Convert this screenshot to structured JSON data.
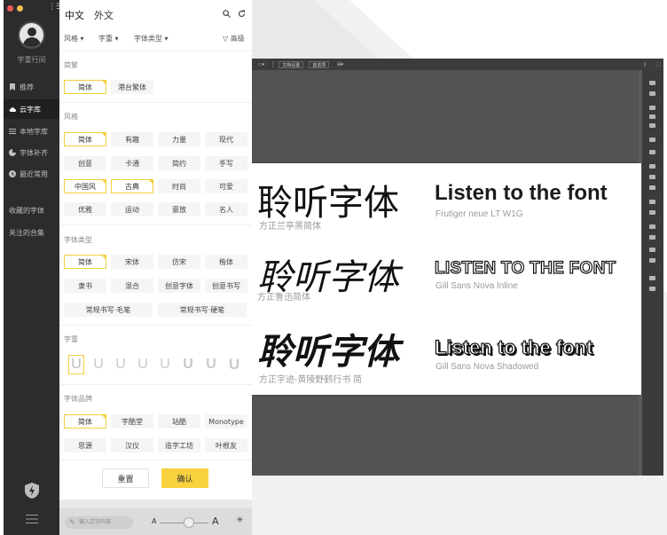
{
  "nav": {
    "brand": "字重行间",
    "items": [
      {
        "label": "推荐",
        "icon": "bookmark-icon"
      },
      {
        "label": "云字库",
        "icon": "cloud-icon"
      },
      {
        "label": "本地字库",
        "icon": "list-icon"
      },
      {
        "label": "字体补齐",
        "icon": "pie-icon"
      },
      {
        "label": "最近常用",
        "icon": "clock-icon"
      }
    ],
    "links": [
      "收藏的字体",
      "关注的合集"
    ]
  },
  "panel": {
    "tabs": [
      "中文",
      "外文"
    ],
    "filters": [
      "风格",
      "字重",
      "字体类型"
    ],
    "advanced": "高级",
    "sections": {
      "traditional": {
        "title": "简繁",
        "options": [
          "简体",
          "港台繁体"
        ]
      },
      "style": {
        "title": "风格",
        "options": [
          "简体",
          "有趣",
          "力量",
          "现代",
          "创意",
          "卡通",
          "简约",
          "手写",
          "中国风",
          "古典",
          "时尚",
          "可爱",
          "优雅",
          "运动",
          "豪放",
          "名人"
        ]
      },
      "type": {
        "title": "字体类型",
        "options": [
          "简体",
          "宋体",
          "仿宋",
          "楷体",
          "隶书",
          "混合",
          "创意字体",
          "创意书写"
        ],
        "wide_options": [
          "常规书写·毛笔",
          "常规书写·硬笔"
        ]
      },
      "weight": {
        "title": "字重",
        "glyph": "U"
      },
      "brand": {
        "title": "字体品牌",
        "options": [
          "简体",
          "字酷堂",
          "站酷",
          "Monotype",
          "思源",
          "汉仪",
          "造字工坊",
          "叶根友"
        ]
      }
    },
    "reset": "重置",
    "confirm": "确认",
    "preview_placeholder": "输入文字内容",
    "size_small": "A",
    "size_large": "A"
  },
  "design_app": {
    "toolbar": [
      "文档设置",
      "首选项"
    ],
    "rows": [
      {
        "cn": "聆听字体",
        "cn_font": "方正兰亭黑简体",
        "en": "Listen to the font",
        "en_font": "Frutiger neue LT W1G"
      },
      {
        "cn": "聆听字体",
        "cn_font": "方正鲁迅简体",
        "en": "LISTEN TO THE FONT",
        "en_font": "Gill Sans Nova Inline"
      },
      {
        "cn": "聆听字体",
        "cn_font": "方正字迹-黄陵野鹤行书 简",
        "en": "Listen to the font",
        "en_font": "Gill Sans Nova Shadowed"
      }
    ]
  },
  "colors": {
    "accent": "#f7d23e",
    "nav_bg": "#2c2c2c",
    "app_bg": "#535353"
  }
}
